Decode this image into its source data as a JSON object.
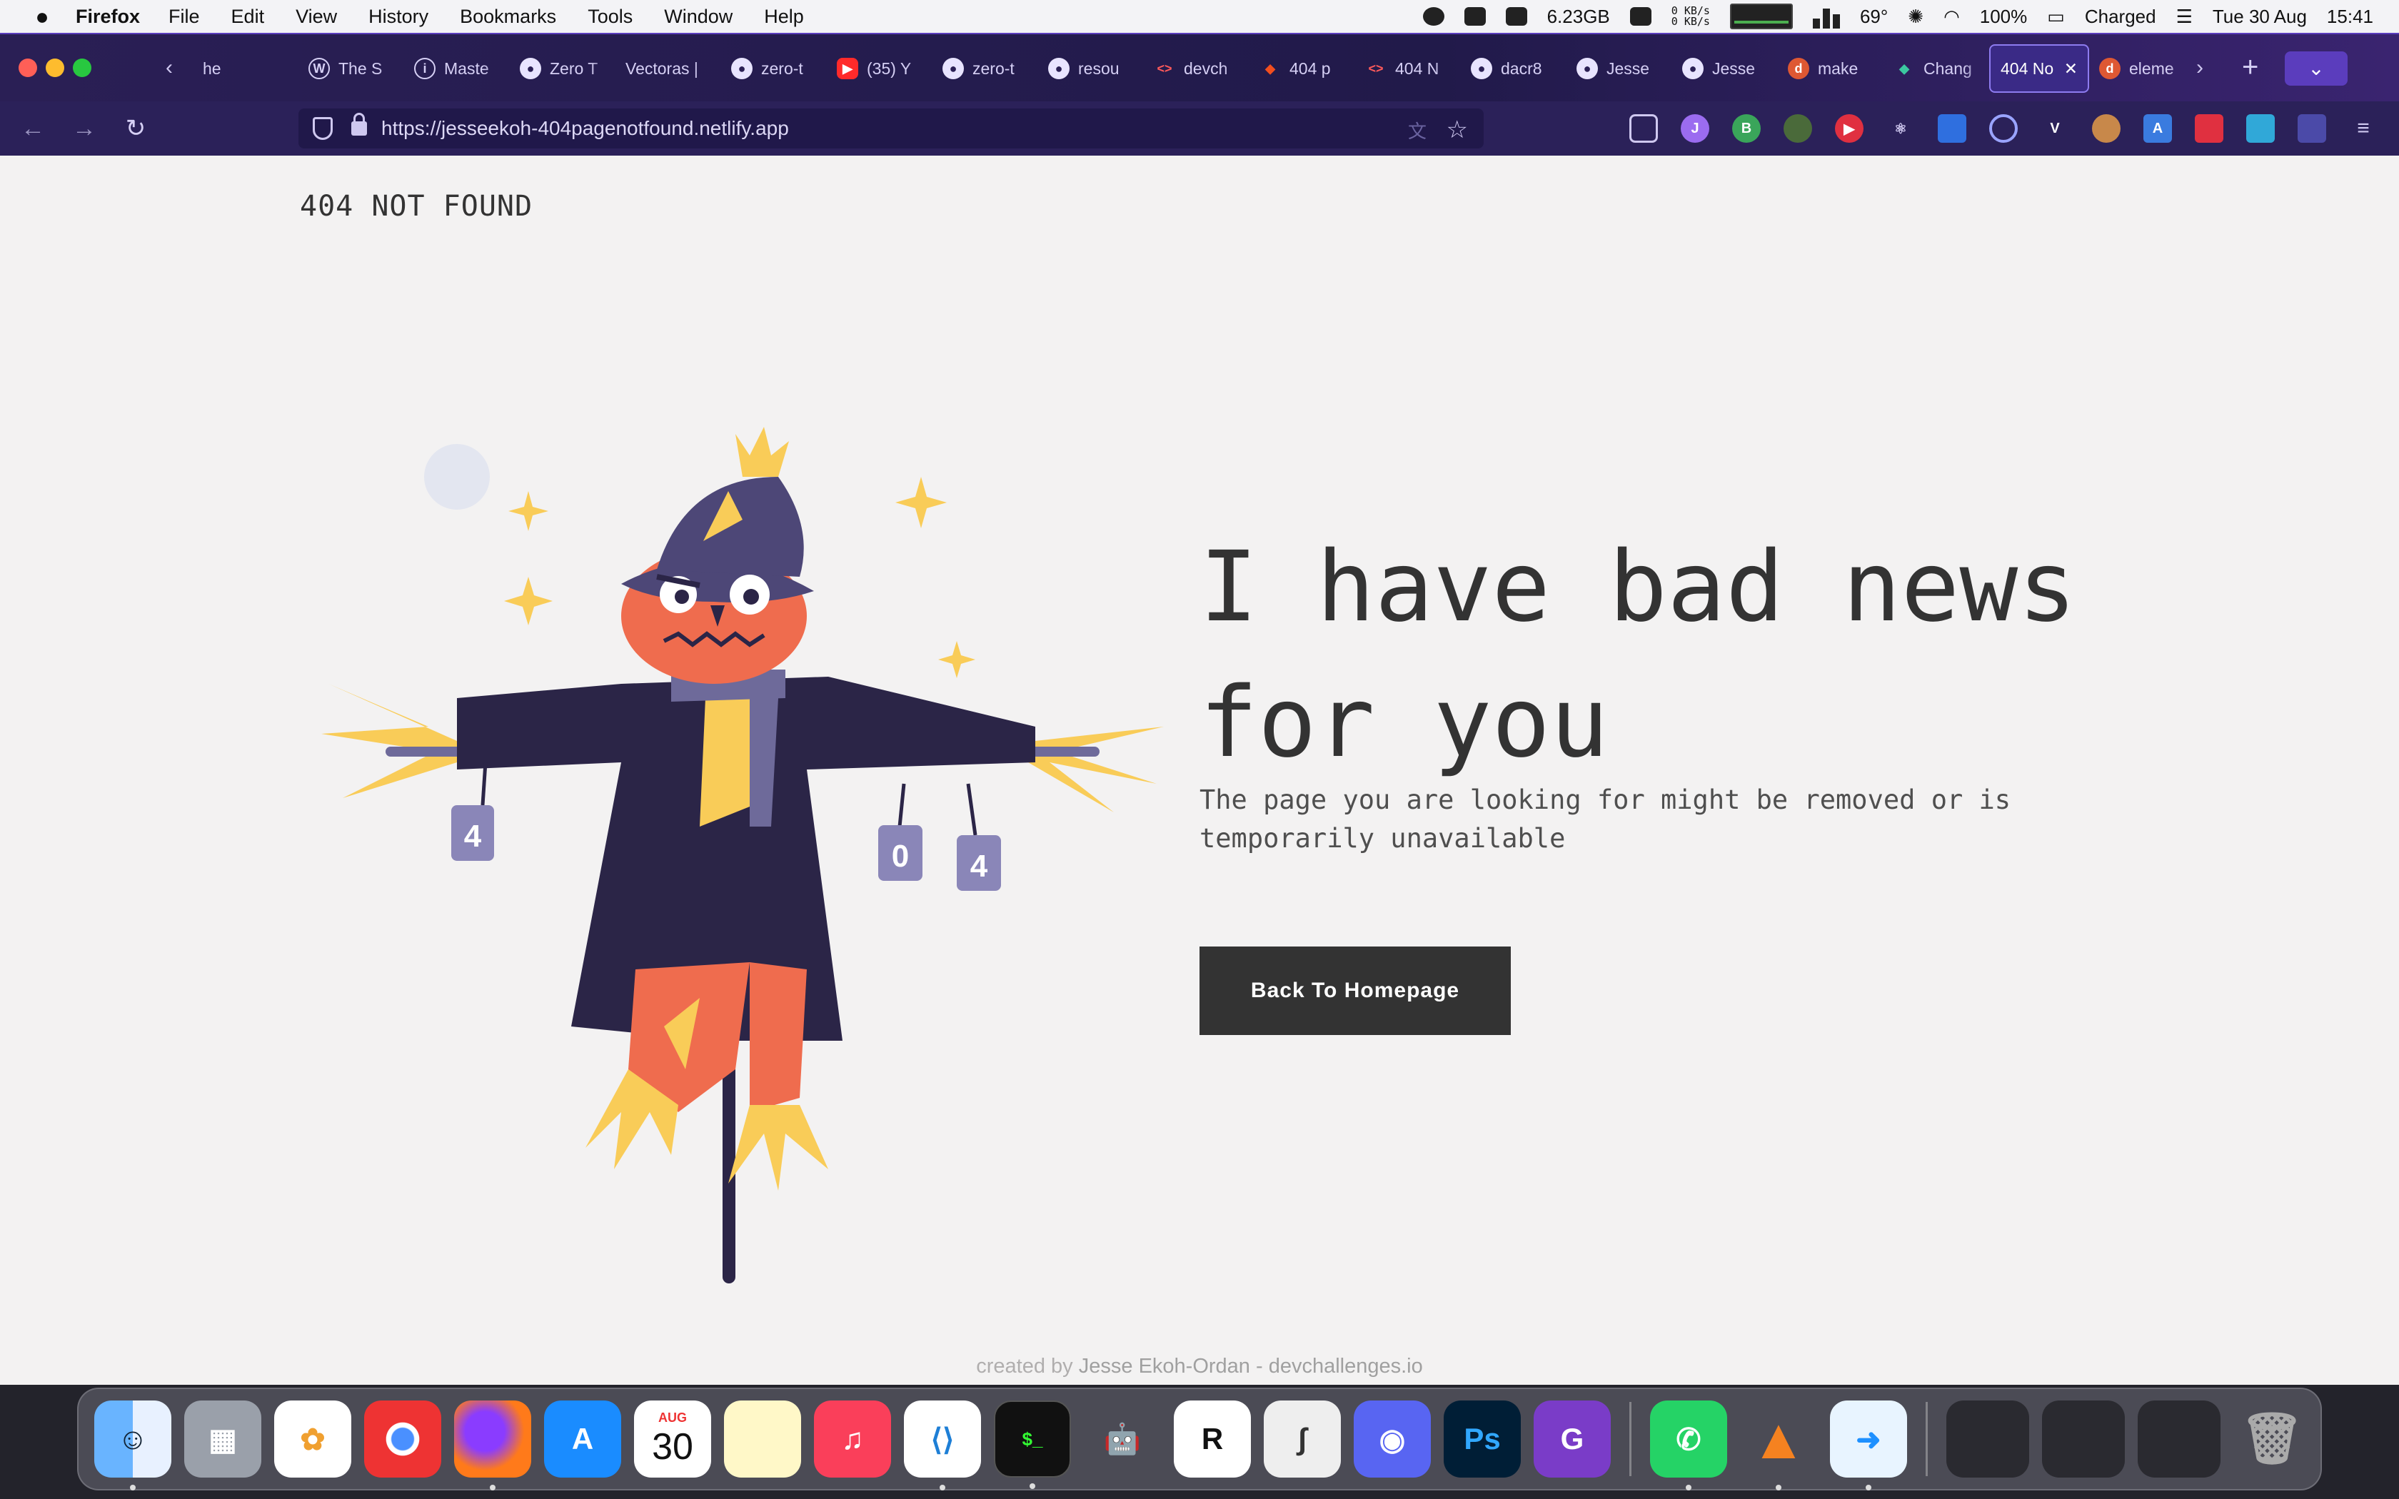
{
  "menubar": {
    "app_name": "Firefox",
    "items": [
      "File",
      "Edit",
      "View",
      "History",
      "Bookmarks",
      "Tools",
      "Window",
      "Help"
    ],
    "memory": "6.23GB",
    "net_up": "0 KB/s",
    "net_down": "0 KB/s",
    "temperature": "69°",
    "battery_percent": "100%",
    "battery_status": "Charged",
    "date": "Tue 30 Aug",
    "time": "15:41"
  },
  "tabs": [
    {
      "label": "he",
      "icon": "generic-icon"
    },
    {
      "label": "The S",
      "icon": "wordpress-icon"
    },
    {
      "label": "Maste",
      "icon": "info-icon"
    },
    {
      "label": "Zero T",
      "icon": "github-icon"
    },
    {
      "label": "Vectoras |",
      "icon": "none"
    },
    {
      "label": "zero-t",
      "icon": "github-icon"
    },
    {
      "label": "(35) Y",
      "icon": "youtube-icon"
    },
    {
      "label": "zero-t",
      "icon": "github-icon"
    },
    {
      "label": "resou",
      "icon": "github-icon"
    },
    {
      "label": "devch",
      "icon": "code-icon"
    },
    {
      "label": "404 p",
      "icon": "figma-icon"
    },
    {
      "label": "404 N",
      "icon": "code-icon"
    },
    {
      "label": "dacr8",
      "icon": "github-icon"
    },
    {
      "label": "Jesse",
      "icon": "github-icon"
    },
    {
      "label": "Jesse",
      "icon": "github-icon"
    },
    {
      "label": "make",
      "icon": "duckduckgo-icon"
    },
    {
      "label": "Chang",
      "icon": "diamond-icon"
    },
    {
      "label": "404 No",
      "icon": "none",
      "active": true
    },
    {
      "label": "eleme",
      "icon": "duckduckgo-icon"
    }
  ],
  "navbar": {
    "url": "https://jesseekoh-404pagenotfound.netlify.app"
  },
  "page": {
    "logo": "404 NOT FOUND",
    "headline": "I have bad news for you",
    "subtext": "The page you are looking for might be removed or is temporarily unavailable",
    "button": "Back To Homepage",
    "footer_prefix": "created by",
    "footer_author": "Jesse Ekoh-Ordan - devchallenges.io",
    "cans": [
      "4",
      "0",
      "4"
    ]
  },
  "dock": {
    "calendar_month": "AUG",
    "calendar_day": "30"
  },
  "colors": {
    "page_bg": "#f3f2f2",
    "text": "#333333",
    "button_bg": "#333333",
    "tab_strip": "#2a1f55",
    "scarecrow_coat": "#2b2547",
    "scarecrow_face": "#ef6c4e",
    "scarecrow_hat": "#4d4777",
    "straw": "#f9cc58"
  }
}
